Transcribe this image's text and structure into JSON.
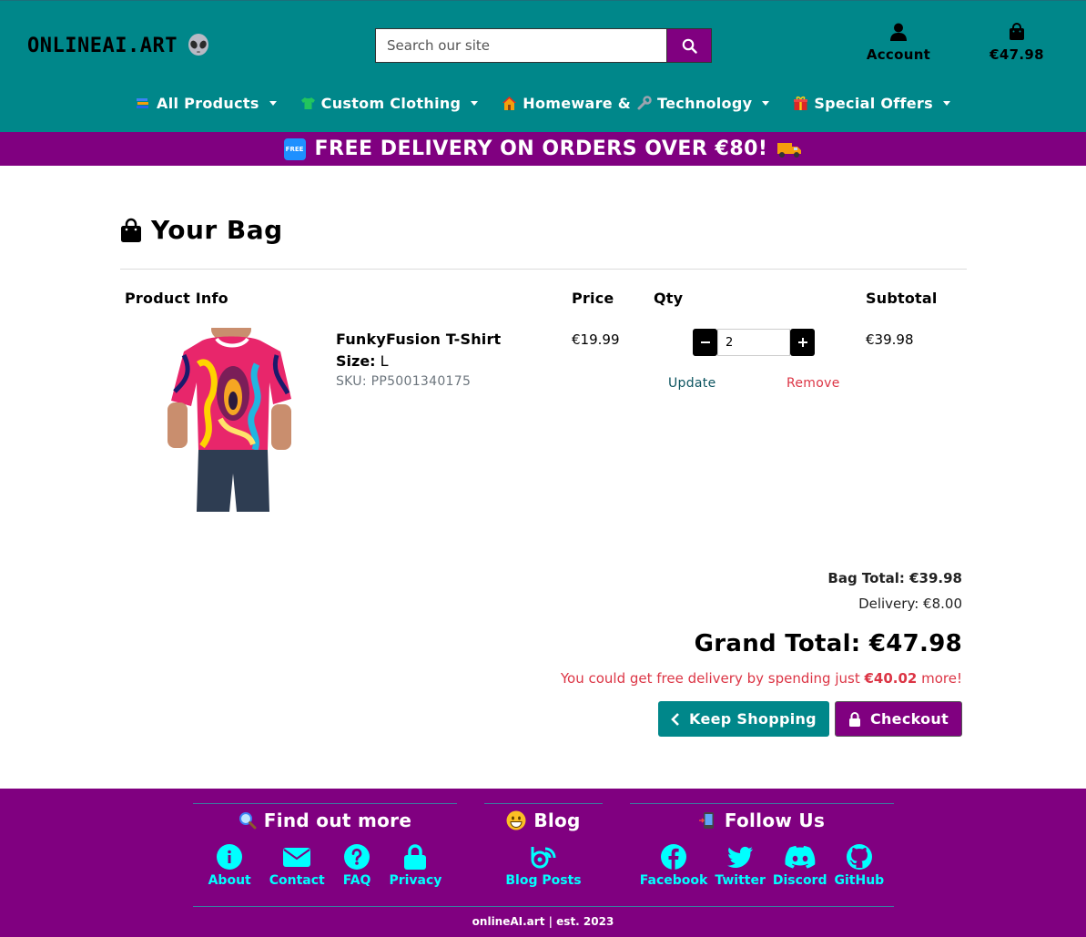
{
  "header": {
    "logo_text": "ONLINEAI.ART",
    "search_placeholder": "Search our site",
    "account_label": "Account",
    "bag_total": "€47.98",
    "colors": {
      "header_bg": "#00878a",
      "accent": "#800080"
    }
  },
  "nav": [
    {
      "label": "All Products",
      "icon": "books-icon"
    },
    {
      "label": "Custom Clothing",
      "icon": "tshirt-icon"
    },
    {
      "label": "Homeware &",
      "icon": "house-icon"
    },
    {
      "label": "Technology",
      "icon": "wrench-icon"
    },
    {
      "label": "Special Offers",
      "icon": "gift-icon"
    }
  ],
  "promo": {
    "badge": "FREE",
    "text": "FREE DELIVERY ON ORDERS OVER €80!"
  },
  "bag": {
    "title": "Your Bag",
    "columns": {
      "product": "Product Info",
      "price": "Price",
      "qty": "Qty",
      "subtotal": "Subtotal"
    },
    "items": [
      {
        "name": "FunkyFusion T-Shirt",
        "size_label": "Size:",
        "size": "L",
        "sku": "SKU: PP5001340175",
        "price": "€19.99",
        "qty": "2",
        "update_label": "Update",
        "remove_label": "Remove",
        "subtotal": "€39.98"
      }
    ],
    "bag_total": "Bag Total: €39.98",
    "delivery": "Delivery: €8.00",
    "grand_total": "Grand Total: €47.98",
    "free_msg_prefix": "You could get free delivery by spending just ",
    "free_msg_amount": "€40.02",
    "free_msg_suffix": " more!",
    "keep_shopping": "Keep Shopping",
    "checkout": "Checkout"
  },
  "footer": {
    "find_out_more": {
      "title": "Find out more",
      "links": [
        "About",
        "Contact",
        "FAQ",
        "Privacy"
      ]
    },
    "blog": {
      "title": "Blog",
      "links": [
        "Blog Posts"
      ]
    },
    "follow": {
      "title": "Follow Us",
      "links": [
        "Facebook",
        "Twitter",
        "Discord",
        "GitHub"
      ]
    },
    "copyright": "onlineAI.art | est. 2023"
  }
}
